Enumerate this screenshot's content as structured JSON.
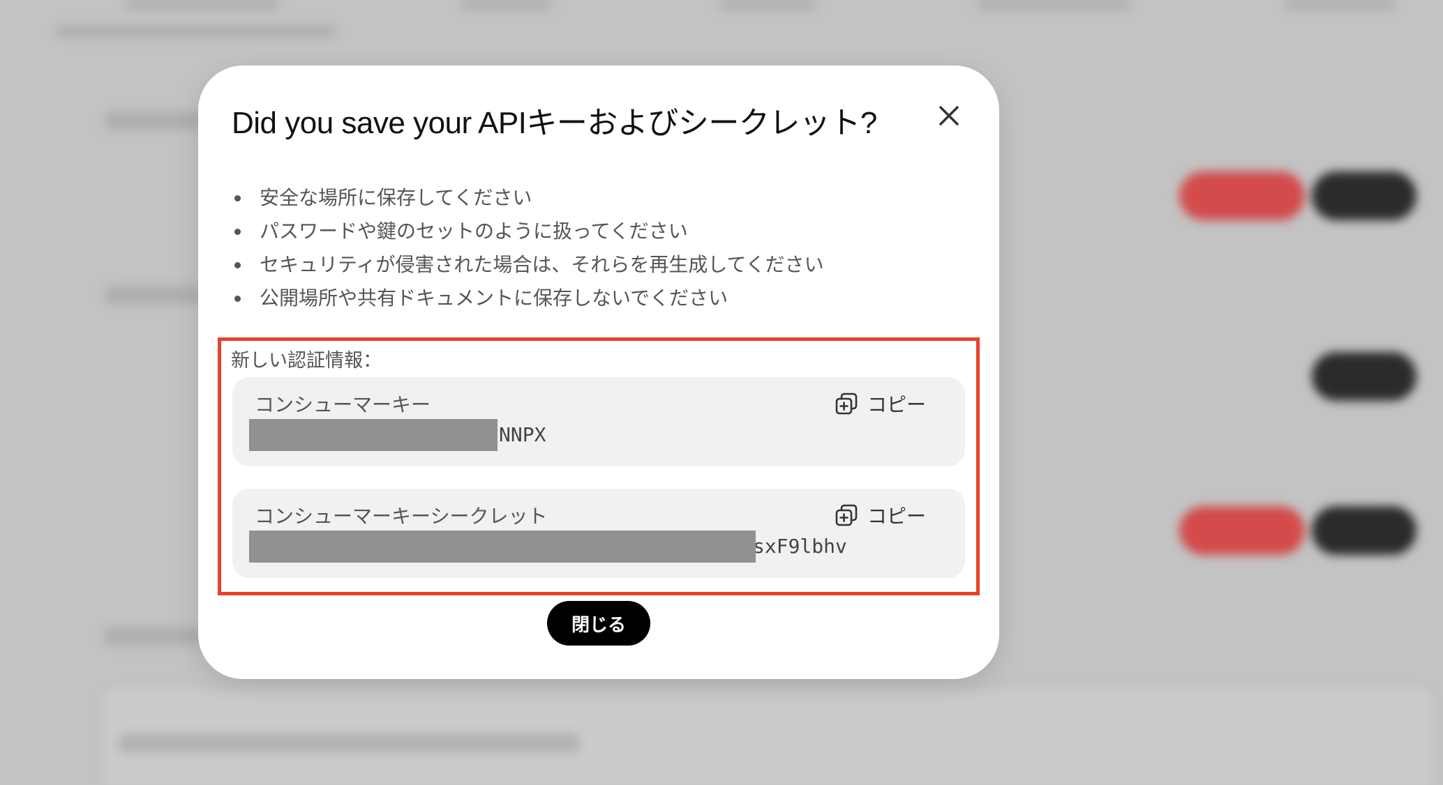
{
  "dialog": {
    "title": "Did you save your APIキーおよびシークレット?",
    "tips": [
      "安全な場所に保存してください",
      "パスワードや鍵のセットのように扱ってください",
      "セキュリティが侵害された場合は、それらを再生成してください",
      "公開場所や共有ドキュメントに保存しないでください"
    ],
    "credentials": {
      "heading": "新しい認証情報：",
      "consumer_key": {
        "label": "コンシューマーキー",
        "value_visible_suffix": "NNPX",
        "copy_label": "コピー"
      },
      "consumer_secret": {
        "label": "コンシューマーキーシークレット",
        "value_visible_suffix": "sxF9lbhv",
        "copy_label": "コピー"
      }
    },
    "close_button_label": "閉じる"
  },
  "colors": {
    "highlight_border": "#e8412b",
    "primary_button": "#000000",
    "card_background": "#f1f1f1",
    "redaction": "#919191"
  },
  "icons": [
    "close-icon",
    "copy-icon"
  ]
}
